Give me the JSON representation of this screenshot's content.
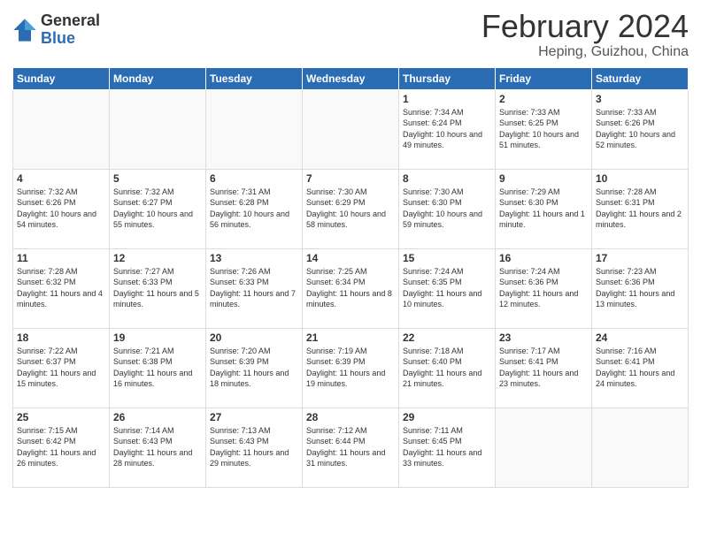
{
  "header": {
    "logo_general": "General",
    "logo_blue": "Blue",
    "month_title": "February 2024",
    "location": "Heping, Guizhou, China"
  },
  "weekdays": [
    "Sunday",
    "Monday",
    "Tuesday",
    "Wednesday",
    "Thursday",
    "Friday",
    "Saturday"
  ],
  "weeks": [
    [
      {
        "day": "",
        "info": ""
      },
      {
        "day": "",
        "info": ""
      },
      {
        "day": "",
        "info": ""
      },
      {
        "day": "",
        "info": ""
      },
      {
        "day": "1",
        "info": "Sunrise: 7:34 AM\nSunset: 6:24 PM\nDaylight: 10 hours and 49 minutes."
      },
      {
        "day": "2",
        "info": "Sunrise: 7:33 AM\nSunset: 6:25 PM\nDaylight: 10 hours and 51 minutes."
      },
      {
        "day": "3",
        "info": "Sunrise: 7:33 AM\nSunset: 6:26 PM\nDaylight: 10 hours and 52 minutes."
      }
    ],
    [
      {
        "day": "4",
        "info": "Sunrise: 7:32 AM\nSunset: 6:26 PM\nDaylight: 10 hours and 54 minutes."
      },
      {
        "day": "5",
        "info": "Sunrise: 7:32 AM\nSunset: 6:27 PM\nDaylight: 10 hours and 55 minutes."
      },
      {
        "day": "6",
        "info": "Sunrise: 7:31 AM\nSunset: 6:28 PM\nDaylight: 10 hours and 56 minutes."
      },
      {
        "day": "7",
        "info": "Sunrise: 7:30 AM\nSunset: 6:29 PM\nDaylight: 10 hours and 58 minutes."
      },
      {
        "day": "8",
        "info": "Sunrise: 7:30 AM\nSunset: 6:30 PM\nDaylight: 10 hours and 59 minutes."
      },
      {
        "day": "9",
        "info": "Sunrise: 7:29 AM\nSunset: 6:30 PM\nDaylight: 11 hours and 1 minute."
      },
      {
        "day": "10",
        "info": "Sunrise: 7:28 AM\nSunset: 6:31 PM\nDaylight: 11 hours and 2 minutes."
      }
    ],
    [
      {
        "day": "11",
        "info": "Sunrise: 7:28 AM\nSunset: 6:32 PM\nDaylight: 11 hours and 4 minutes."
      },
      {
        "day": "12",
        "info": "Sunrise: 7:27 AM\nSunset: 6:33 PM\nDaylight: 11 hours and 5 minutes."
      },
      {
        "day": "13",
        "info": "Sunrise: 7:26 AM\nSunset: 6:33 PM\nDaylight: 11 hours and 7 minutes."
      },
      {
        "day": "14",
        "info": "Sunrise: 7:25 AM\nSunset: 6:34 PM\nDaylight: 11 hours and 8 minutes."
      },
      {
        "day": "15",
        "info": "Sunrise: 7:24 AM\nSunset: 6:35 PM\nDaylight: 11 hours and 10 minutes."
      },
      {
        "day": "16",
        "info": "Sunrise: 7:24 AM\nSunset: 6:36 PM\nDaylight: 11 hours and 12 minutes."
      },
      {
        "day": "17",
        "info": "Sunrise: 7:23 AM\nSunset: 6:36 PM\nDaylight: 11 hours and 13 minutes."
      }
    ],
    [
      {
        "day": "18",
        "info": "Sunrise: 7:22 AM\nSunset: 6:37 PM\nDaylight: 11 hours and 15 minutes."
      },
      {
        "day": "19",
        "info": "Sunrise: 7:21 AM\nSunset: 6:38 PM\nDaylight: 11 hours and 16 minutes."
      },
      {
        "day": "20",
        "info": "Sunrise: 7:20 AM\nSunset: 6:39 PM\nDaylight: 11 hours and 18 minutes."
      },
      {
        "day": "21",
        "info": "Sunrise: 7:19 AM\nSunset: 6:39 PM\nDaylight: 11 hours and 19 minutes."
      },
      {
        "day": "22",
        "info": "Sunrise: 7:18 AM\nSunset: 6:40 PM\nDaylight: 11 hours and 21 minutes."
      },
      {
        "day": "23",
        "info": "Sunrise: 7:17 AM\nSunset: 6:41 PM\nDaylight: 11 hours and 23 minutes."
      },
      {
        "day": "24",
        "info": "Sunrise: 7:16 AM\nSunset: 6:41 PM\nDaylight: 11 hours and 24 minutes."
      }
    ],
    [
      {
        "day": "25",
        "info": "Sunrise: 7:15 AM\nSunset: 6:42 PM\nDaylight: 11 hours and 26 minutes."
      },
      {
        "day": "26",
        "info": "Sunrise: 7:14 AM\nSunset: 6:43 PM\nDaylight: 11 hours and 28 minutes."
      },
      {
        "day": "27",
        "info": "Sunrise: 7:13 AM\nSunset: 6:43 PM\nDaylight: 11 hours and 29 minutes."
      },
      {
        "day": "28",
        "info": "Sunrise: 7:12 AM\nSunset: 6:44 PM\nDaylight: 11 hours and 31 minutes."
      },
      {
        "day": "29",
        "info": "Sunrise: 7:11 AM\nSunset: 6:45 PM\nDaylight: 11 hours and 33 minutes."
      },
      {
        "day": "",
        "info": ""
      },
      {
        "day": "",
        "info": ""
      }
    ]
  ]
}
